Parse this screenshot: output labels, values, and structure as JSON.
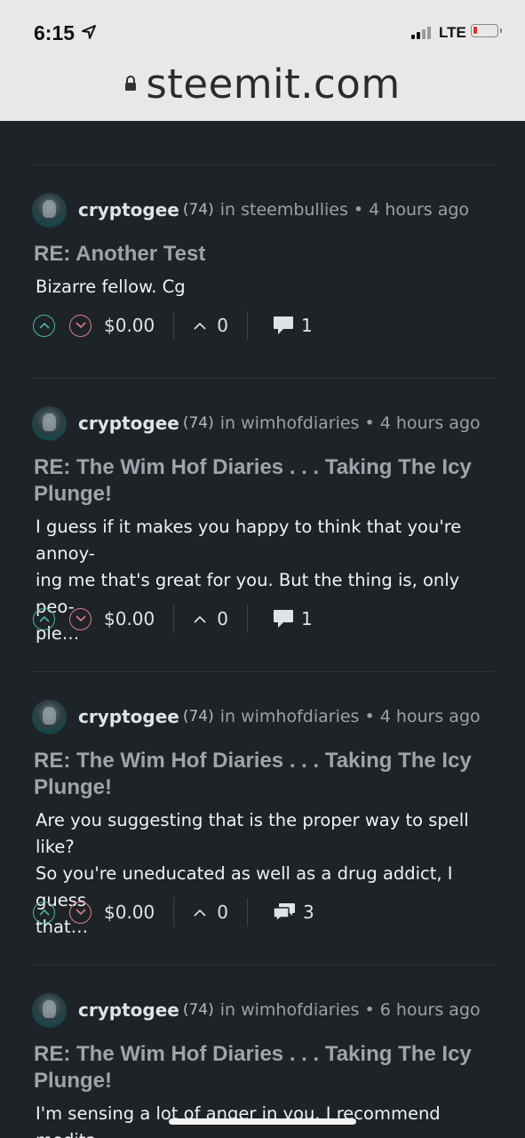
{
  "status_bar": {
    "time": "6:15",
    "network": "LTE",
    "icons": [
      "location-arrow-icon",
      "signal-icon",
      "battery-icon"
    ]
  },
  "browser": {
    "url": "steemit.com",
    "icons": [
      "lock-icon"
    ]
  },
  "posts": [
    {
      "author": "cryptogee",
      "reputation": "(74)",
      "category": "in steembullies • 4 hours ago",
      "title": "RE: Another Test",
      "body": "Bizarre fellow. Cg",
      "payout": "$0.00",
      "votes": "0",
      "replies": "1"
    },
    {
      "author": "cryptogee",
      "reputation": "(74)",
      "category": "in wimhofdiaries • 4 hours ago",
      "title": "RE: The Wim Hof Diaries . . . Taking The Icy Plunge!",
      "body": "I guess if it makes you happy to think that you're annoy-\ning me that's great for you. But the thing is, only peo-\nple…",
      "payout": "$0.00",
      "votes": "0",
      "replies": "1"
    },
    {
      "author": "cryptogee",
      "reputation": "(74)",
      "category": "in wimhofdiaries • 4 hours ago",
      "title": "RE: The Wim Hof Diaries . . . Taking The Icy Plunge!",
      "body": "Are you suggesting that is the proper way to spell like?\nSo you're uneducated as well as a drug addict, I guess\nthat…",
      "payout": "$0.00",
      "votes": "0",
      "replies": "3"
    },
    {
      "author": "cryptogee",
      "reputation": "(74)",
      "category": "in wimhofdiaries • 6 hours ago",
      "title": "RE: The Wim Hof Diaries . . . Taking The Icy Plunge!",
      "body": "I'm sensing a lot of anger in you. I recommend medita-"
    }
  ]
}
